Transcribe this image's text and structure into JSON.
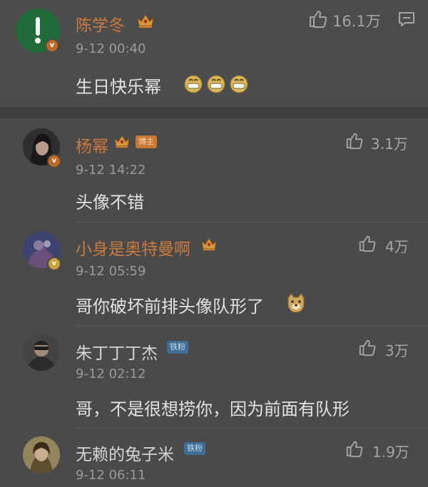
{
  "main_comment": {
    "username": "陈学冬",
    "time": "9-12 00:40",
    "text": "生日快乐幂",
    "emoji": "grin-emoji",
    "likes": "16.1万"
  },
  "replies": [
    {
      "username": "杨幂",
      "tag": "博主",
      "time": "9-12 14:22",
      "text": "头像不错",
      "likes": "3.1万"
    },
    {
      "username": "小身是奥特曼啊",
      "time": "9-12 05:59",
      "text": "哥你破坏前排头像队形了",
      "emoji": "doge-emoji",
      "likes": "4万"
    },
    {
      "username": "朱丁丁丁杰",
      "tag": "铁粉",
      "time": "9-12 02:12",
      "text": "哥，不是很想捞你，因为前面有队形",
      "likes": "3万"
    },
    {
      "username": "无赖的兔子米",
      "tag": "铁粉",
      "time": "9-12 06:11",
      "likes": "1.9万"
    }
  ],
  "colors": {
    "background": "#4a4a4a",
    "username": "#c97a3e",
    "author_tag": "#c87a34",
    "fan_tag": "#3f6e94"
  }
}
